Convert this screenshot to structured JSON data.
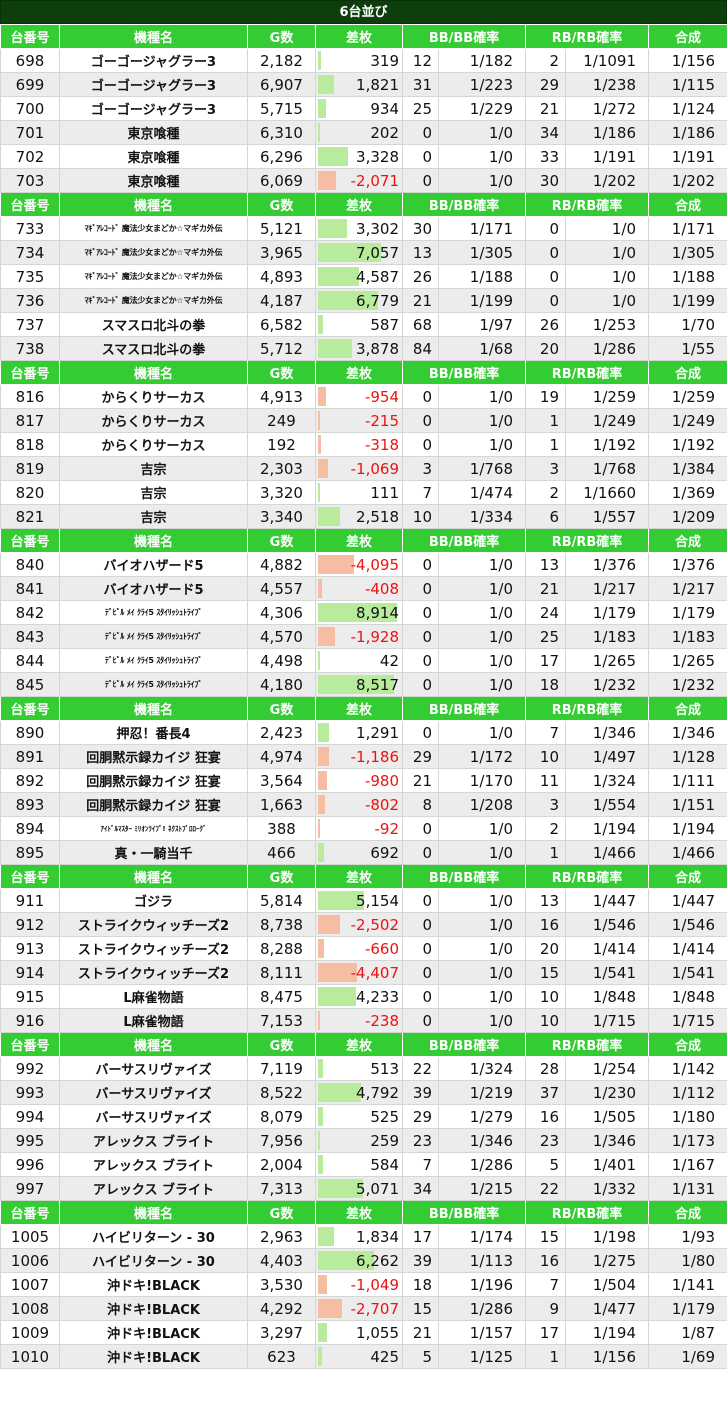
{
  "title": "6台並び",
  "headers": {
    "dai": "台番号",
    "kishu": "機種名",
    "g": "G数",
    "diff": "差枚",
    "bb": "BB/BB確率",
    "rb": "RB/RB確率",
    "comb": "合成"
  },
  "colors": {
    "header_bg": "#33cc33",
    "title_bg": "#0d3f0d",
    "positive_bar": "#b9eb9d",
    "negative_bar": "#f6bda3",
    "negative_text": "#ee1111"
  },
  "groups": [
    {
      "rows": [
        {
          "dai": "698",
          "name": "ゴーゴージャグラー3",
          "g": "2,182",
          "diff": "319",
          "diff_value": 319,
          "bb": "12",
          "bbp": "1/182",
          "rb": "2",
          "rbp": "1/1091",
          "comb": "1/156"
        },
        {
          "dai": "699",
          "name": "ゴーゴージャグラー3",
          "g": "6,907",
          "diff": "1,821",
          "diff_value": 1821,
          "bb": "31",
          "bbp": "1/223",
          "rb": "29",
          "rbp": "1/238",
          "comb": "1/115"
        },
        {
          "dai": "700",
          "name": "ゴーゴージャグラー3",
          "g": "5,715",
          "diff": "934",
          "diff_value": 934,
          "bb": "25",
          "bbp": "1/229",
          "rb": "21",
          "rbp": "1/272",
          "comb": "1/124"
        },
        {
          "dai": "701",
          "name": "東京喰種",
          "g": "6,310",
          "diff": "202",
          "diff_value": 202,
          "bb": "0",
          "bbp": "1/0",
          "rb": "34",
          "rbp": "1/186",
          "comb": "1/186"
        },
        {
          "dai": "702",
          "name": "東京喰種",
          "g": "6,296",
          "diff": "3,328",
          "diff_value": 3328,
          "bb": "0",
          "bbp": "1/0",
          "rb": "33",
          "rbp": "1/191",
          "comb": "1/191"
        },
        {
          "dai": "703",
          "name": "東京喰種",
          "g": "6,069",
          "diff": "-2,071",
          "diff_value": -2071,
          "bb": "0",
          "bbp": "1/0",
          "rb": "30",
          "rbp": "1/202",
          "comb": "1/202"
        }
      ]
    },
    {
      "rows": [
        {
          "dai": "733",
          "name": "ﾏｷﾞｱﾚｺｰﾄﾞ 魔法少女まどか☆マギカ外伝",
          "g": "5,121",
          "diff": "3,302",
          "diff_value": 3302,
          "bb": "30",
          "bbp": "1/171",
          "rb": "0",
          "rbp": "1/0",
          "comb": "1/171",
          "size": "small"
        },
        {
          "dai": "734",
          "name": "ﾏｷﾞｱﾚｺｰﾄﾞ 魔法少女まどか☆マギカ外伝",
          "g": "3,965",
          "diff": "7,057",
          "diff_value": 7057,
          "bb": "13",
          "bbp": "1/305",
          "rb": "0",
          "rbp": "1/0",
          "comb": "1/305",
          "size": "small"
        },
        {
          "dai": "735",
          "name": "ﾏｷﾞｱﾚｺｰﾄﾞ 魔法少女まどか☆マギカ外伝",
          "g": "4,893",
          "diff": "4,587",
          "diff_value": 4587,
          "bb": "26",
          "bbp": "1/188",
          "rb": "0",
          "rbp": "1/0",
          "comb": "1/188",
          "size": "small"
        },
        {
          "dai": "736",
          "name": "ﾏｷﾞｱﾚｺｰﾄﾞ 魔法少女まどか☆マギカ外伝",
          "g": "4,187",
          "diff": "6,779",
          "diff_value": 6779,
          "bb": "21",
          "bbp": "1/199",
          "rb": "0",
          "rbp": "1/0",
          "comb": "1/199",
          "size": "small"
        },
        {
          "dai": "737",
          "name": "スマスロ北斗の拳",
          "g": "6,582",
          "diff": "587",
          "diff_value": 587,
          "bb": "68",
          "bbp": "1/97",
          "rb": "26",
          "rbp": "1/253",
          "comb": "1/70"
        },
        {
          "dai": "738",
          "name": "スマスロ北斗の拳",
          "g": "5,712",
          "diff": "3,878",
          "diff_value": 3878,
          "bb": "84",
          "bbp": "1/68",
          "rb": "20",
          "rbp": "1/286",
          "comb": "1/55"
        }
      ]
    },
    {
      "rows": [
        {
          "dai": "816",
          "name": "からくりサーカス",
          "g": "4,913",
          "diff": "-954",
          "diff_value": -954,
          "bb": "0",
          "bbp": "1/0",
          "rb": "19",
          "rbp": "1/259",
          "comb": "1/259"
        },
        {
          "dai": "817",
          "name": "からくりサーカス",
          "g": "249",
          "diff": "-215",
          "diff_value": -215,
          "bb": "0",
          "bbp": "1/0",
          "rb": "1",
          "rbp": "1/249",
          "comb": "1/249"
        },
        {
          "dai": "818",
          "name": "からくりサーカス",
          "g": "192",
          "diff": "-318",
          "diff_value": -318,
          "bb": "0",
          "bbp": "1/0",
          "rb": "1",
          "rbp": "1/192",
          "comb": "1/192"
        },
        {
          "dai": "819",
          "name": "吉宗",
          "g": "2,303",
          "diff": "-1,069",
          "diff_value": -1069,
          "bb": "3",
          "bbp": "1/768",
          "rb": "3",
          "rbp": "1/768",
          "comb": "1/384"
        },
        {
          "dai": "820",
          "name": "吉宗",
          "g": "3,320",
          "diff": "111",
          "diff_value": 111,
          "bb": "7",
          "bbp": "1/474",
          "rb": "2",
          "rbp": "1/1660",
          "comb": "1/369"
        },
        {
          "dai": "821",
          "name": "吉宗",
          "g": "3,340",
          "diff": "2,518",
          "diff_value": 2518,
          "bb": "10",
          "bbp": "1/334",
          "rb": "6",
          "rbp": "1/557",
          "comb": "1/209"
        }
      ]
    },
    {
      "rows": [
        {
          "dai": "840",
          "name": "バイオハザード5",
          "g": "4,882",
          "diff": "-4,095",
          "diff_value": -4095,
          "bb": "0",
          "bbp": "1/0",
          "rb": "13",
          "rbp": "1/376",
          "comb": "1/376"
        },
        {
          "dai": "841",
          "name": "バイオハザード5",
          "g": "4,557",
          "diff": "-408",
          "diff_value": -408,
          "bb": "0",
          "bbp": "1/0",
          "rb": "21",
          "rbp": "1/217",
          "comb": "1/217"
        },
        {
          "dai": "842",
          "name": "ﾃﾞﾋﾞﾙ ﾒｲ ｸﾗｲ5 ｽﾀｲﾘｯｼｭﾄﾗｲﾌﾞ",
          "g": "4,306",
          "diff": "8,914",
          "diff_value": 8914,
          "bb": "0",
          "bbp": "1/0",
          "rb": "24",
          "rbp": "1/179",
          "comb": "1/179",
          "size": "small"
        },
        {
          "dai": "843",
          "name": "ﾃﾞﾋﾞﾙ ﾒｲ ｸﾗｲ5 ｽﾀｲﾘｯｼｭﾄﾗｲﾌﾞ",
          "g": "4,570",
          "diff": "-1,928",
          "diff_value": -1928,
          "bb": "0",
          "bbp": "1/0",
          "rb": "25",
          "rbp": "1/183",
          "comb": "1/183",
          "size": "small"
        },
        {
          "dai": "844",
          "name": "ﾃﾞﾋﾞﾙ ﾒｲ ｸﾗｲ5 ｽﾀｲﾘｯｼｭﾄﾗｲﾌﾞ",
          "g": "4,498",
          "diff": "42",
          "diff_value": 42,
          "bb": "0",
          "bbp": "1/0",
          "rb": "17",
          "rbp": "1/265",
          "comb": "1/265",
          "size": "small"
        },
        {
          "dai": "845",
          "name": "ﾃﾞﾋﾞﾙ ﾒｲ ｸﾗｲ5 ｽﾀｲﾘｯｼｭﾄﾗｲﾌﾞ",
          "g": "4,180",
          "diff": "8,517",
          "diff_value": 8517,
          "bb": "0",
          "bbp": "1/0",
          "rb": "18",
          "rbp": "1/232",
          "comb": "1/232",
          "size": "small"
        }
      ]
    },
    {
      "rows": [
        {
          "dai": "890",
          "name": "押忍！番長4",
          "g": "2,423",
          "diff": "1,291",
          "diff_value": 1291,
          "bb": "0",
          "bbp": "1/0",
          "rb": "7",
          "rbp": "1/346",
          "comb": "1/346"
        },
        {
          "dai": "891",
          "name": "回胴黙示録カイジ 狂宴",
          "g": "4,974",
          "diff": "-1,186",
          "diff_value": -1186,
          "bb": "29",
          "bbp": "1/172",
          "rb": "10",
          "rbp": "1/497",
          "comb": "1/128"
        },
        {
          "dai": "892",
          "name": "回胴黙示録カイジ 狂宴",
          "g": "3,564",
          "diff": "-980",
          "diff_value": -980,
          "bb": "21",
          "bbp": "1/170",
          "rb": "11",
          "rbp": "1/324",
          "comb": "1/111"
        },
        {
          "dai": "893",
          "name": "回胴黙示録カイジ 狂宴",
          "g": "1,663",
          "diff": "-802",
          "diff_value": -802,
          "bb": "8",
          "bbp": "1/208",
          "rb": "3",
          "rbp": "1/554",
          "comb": "1/151"
        },
        {
          "dai": "894",
          "name": "ｱｲﾄﾞﾙﾏｽﾀｰ ﾐﾘｵﾝﾗｲﾌﾞ! ﾈｸｽﾄﾌﾟﾛﾛｰｸﾞ",
          "g": "388",
          "diff": "-92",
          "diff_value": -92,
          "bb": "0",
          "bbp": "1/0",
          "rb": "2",
          "rbp": "1/194",
          "comb": "1/194",
          "size": "tiny"
        },
        {
          "dai": "895",
          "name": "真・一騎当千",
          "g": "466",
          "diff": "692",
          "diff_value": 692,
          "bb": "0",
          "bbp": "1/0",
          "rb": "1",
          "rbp": "1/466",
          "comb": "1/466"
        }
      ]
    },
    {
      "rows": [
        {
          "dai": "911",
          "name": "ゴジラ",
          "g": "5,814",
          "diff": "5,154",
          "diff_value": 5154,
          "bb": "0",
          "bbp": "1/0",
          "rb": "13",
          "rbp": "1/447",
          "comb": "1/447"
        },
        {
          "dai": "912",
          "name": "ストライクウィッチーズ2",
          "g": "8,738",
          "diff": "-2,502",
          "diff_value": -2502,
          "bb": "0",
          "bbp": "1/0",
          "rb": "16",
          "rbp": "1/546",
          "comb": "1/546"
        },
        {
          "dai": "913",
          "name": "ストライクウィッチーズ2",
          "g": "8,288",
          "diff": "-660",
          "diff_value": -660,
          "bb": "0",
          "bbp": "1/0",
          "rb": "20",
          "rbp": "1/414",
          "comb": "1/414"
        },
        {
          "dai": "914",
          "name": "ストライクウィッチーズ2",
          "g": "8,111",
          "diff": "-4,407",
          "diff_value": -4407,
          "bb": "0",
          "bbp": "1/0",
          "rb": "15",
          "rbp": "1/541",
          "comb": "1/541"
        },
        {
          "dai": "915",
          "name": "L麻雀物語",
          "g": "8,475",
          "diff": "4,233",
          "diff_value": 4233,
          "bb": "0",
          "bbp": "1/0",
          "rb": "10",
          "rbp": "1/848",
          "comb": "1/848"
        },
        {
          "dai": "916",
          "name": "L麻雀物語",
          "g": "7,153",
          "diff": "-238",
          "diff_value": -238,
          "bb": "0",
          "bbp": "1/0",
          "rb": "10",
          "rbp": "1/715",
          "comb": "1/715"
        }
      ]
    },
    {
      "rows": [
        {
          "dai": "992",
          "name": "バーサスリヴァイズ",
          "g": "7,119",
          "diff": "513",
          "diff_value": 513,
          "bb": "22",
          "bbp": "1/324",
          "rb": "28",
          "rbp": "1/254",
          "comb": "1/142"
        },
        {
          "dai": "993",
          "name": "バーサスリヴァイズ",
          "g": "8,522",
          "diff": "4,792",
          "diff_value": 4792,
          "bb": "39",
          "bbp": "1/219",
          "rb": "37",
          "rbp": "1/230",
          "comb": "1/112"
        },
        {
          "dai": "994",
          "name": "バーサスリヴァイズ",
          "g": "8,079",
          "diff": "525",
          "diff_value": 525,
          "bb": "29",
          "bbp": "1/279",
          "rb": "16",
          "rbp": "1/505",
          "comb": "1/180"
        },
        {
          "dai": "995",
          "name": "アレックス ブライト",
          "g": "7,956",
          "diff": "259",
          "diff_value": 259,
          "bb": "23",
          "bbp": "1/346",
          "rb": "23",
          "rbp": "1/346",
          "comb": "1/173"
        },
        {
          "dai": "996",
          "name": "アレックス ブライト",
          "g": "2,004",
          "diff": "584",
          "diff_value": 584,
          "bb": "7",
          "bbp": "1/286",
          "rb": "5",
          "rbp": "1/401",
          "comb": "1/167"
        },
        {
          "dai": "997",
          "name": "アレックス ブライト",
          "g": "7,313",
          "diff": "5,071",
          "diff_value": 5071,
          "bb": "34",
          "bbp": "1/215",
          "rb": "22",
          "rbp": "1/332",
          "comb": "1/131"
        }
      ]
    },
    {
      "rows": [
        {
          "dai": "1005",
          "name": "ハイビリターン - 30",
          "g": "2,963",
          "diff": "1,834",
          "diff_value": 1834,
          "bb": "17",
          "bbp": "1/174",
          "rb": "15",
          "rbp": "1/198",
          "comb": "1/93"
        },
        {
          "dai": "1006",
          "name": "ハイビリターン - 30",
          "g": "4,403",
          "diff": "6,262",
          "diff_value": 6262,
          "bb": "39",
          "bbp": "1/113",
          "rb": "16",
          "rbp": "1/275",
          "comb": "1/80"
        },
        {
          "dai": "1007",
          "name": "沖ドキ!BLACK",
          "g": "3,530",
          "diff": "-1,049",
          "diff_value": -1049,
          "bb": "18",
          "bbp": "1/196",
          "rb": "7",
          "rbp": "1/504",
          "comb": "1/141"
        },
        {
          "dai": "1008",
          "name": "沖ドキ!BLACK",
          "g": "4,292",
          "diff": "-2,707",
          "diff_value": -2707,
          "bb": "15",
          "bbp": "1/286",
          "rb": "9",
          "rbp": "1/477",
          "comb": "1/179"
        },
        {
          "dai": "1009",
          "name": "沖ドキ!BLACK",
          "g": "3,297",
          "diff": "1,055",
          "diff_value": 1055,
          "bb": "21",
          "bbp": "1/157",
          "rb": "17",
          "rbp": "1/194",
          "comb": "1/87"
        },
        {
          "dai": "1010",
          "name": "沖ドキ!BLACK",
          "g": "623",
          "diff": "425",
          "diff_value": 425,
          "bb": "5",
          "bbp": "1/125",
          "rb": "1",
          "rbp": "1/156",
          "comb": "1/69"
        }
      ]
    }
  ]
}
